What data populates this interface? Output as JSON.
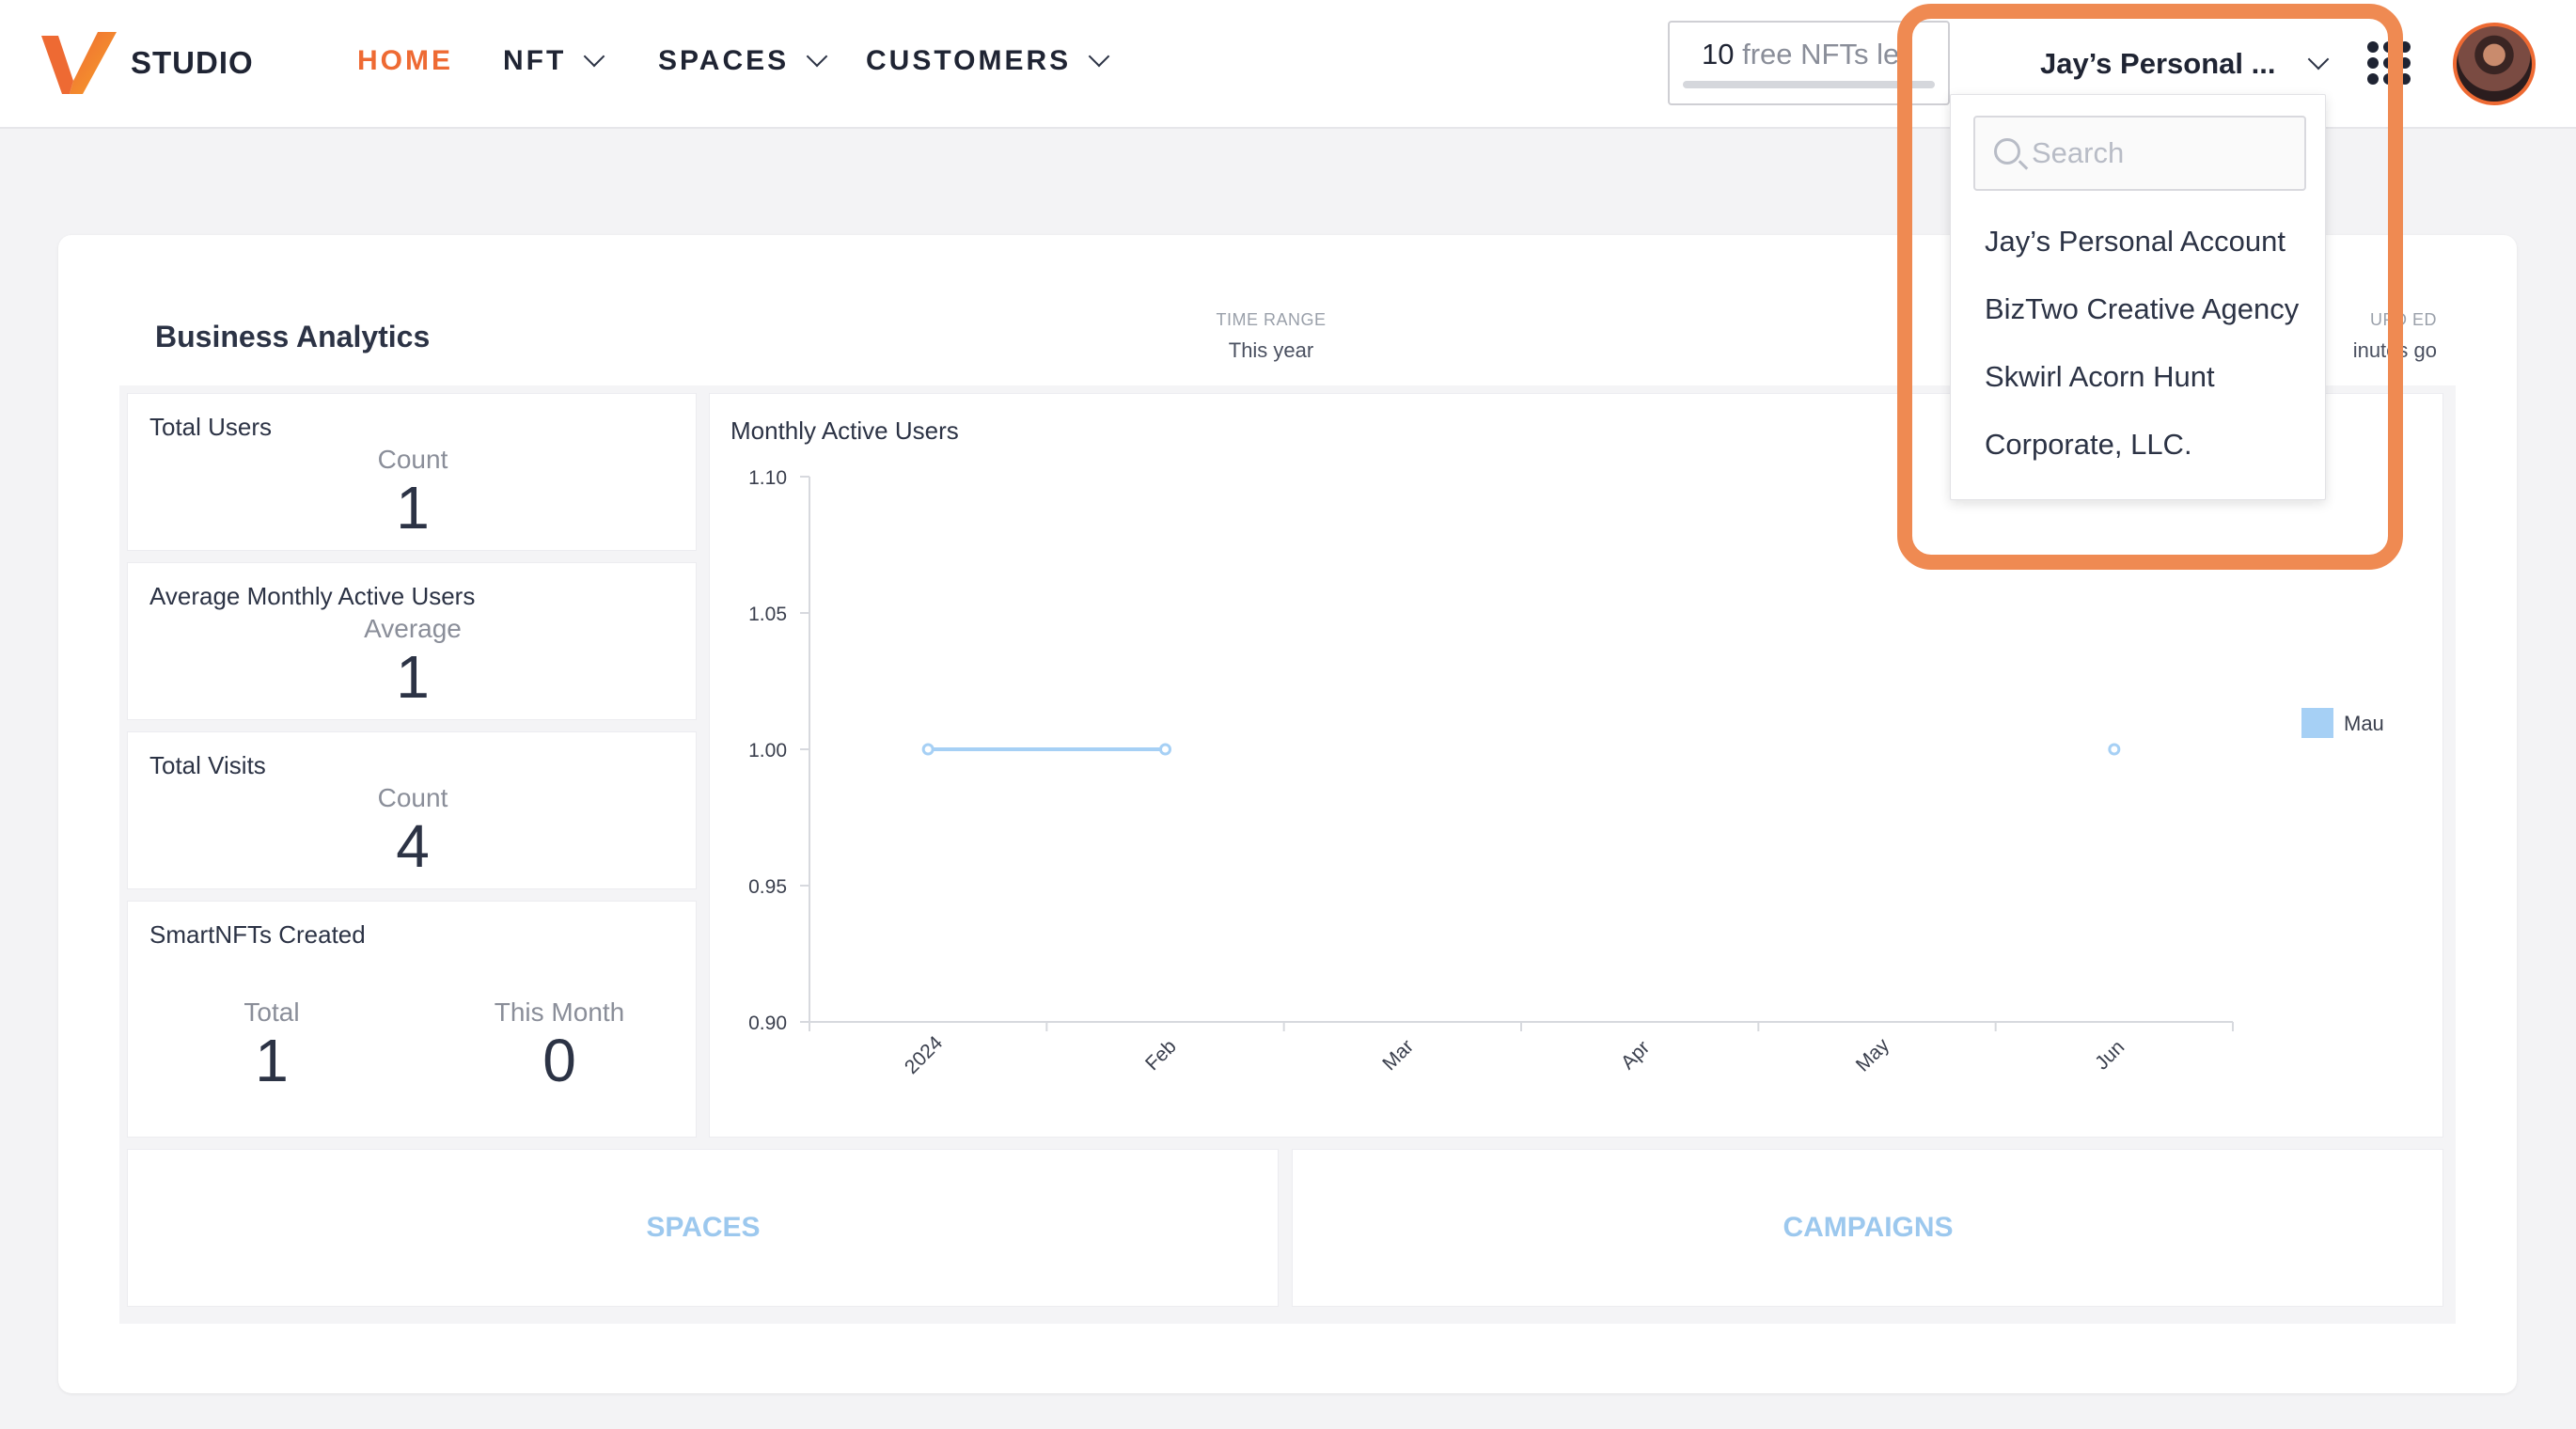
{
  "header": {
    "brand": "STUDIO",
    "nav": [
      {
        "label": "HOME",
        "active": true,
        "has_menu": false
      },
      {
        "label": "NFT",
        "active": false,
        "has_menu": true
      },
      {
        "label": "SPACES",
        "active": false,
        "has_menu": true
      },
      {
        "label": "CUSTOMERS",
        "active": false,
        "has_menu": true
      }
    ],
    "free_nfts": {
      "count": "10",
      "text": "free NFTs le"
    },
    "account_label": "Jay’s Personal ...",
    "accent_color": "#ee6a33"
  },
  "account_dropdown": {
    "search_placeholder": "Search",
    "items": [
      "Jay’s Personal Account",
      "BizTwo Creative Agency",
      "Skwirl Acorn Hunt",
      "Corporate, LLC."
    ]
  },
  "analytics": {
    "title": "Business Analytics",
    "time_range_label": "TIME RANGE",
    "time_range_value": "This year",
    "updated_label": "UPD ED",
    "updated_value": "inutes go"
  },
  "tiles": {
    "total_users": {
      "title": "Total Users",
      "label": "Count",
      "value": "1"
    },
    "avg_mau": {
      "title": "Average Monthly Active Users",
      "label": "Average",
      "value": "1"
    },
    "total_visits": {
      "title": "Total Visits",
      "label": "Count",
      "value": "4"
    },
    "smartnfts": {
      "title": "SmartNFTs Created",
      "total_label": "Total",
      "total_value": "1",
      "month_label": "This Month",
      "month_value": "0"
    }
  },
  "sections": {
    "spaces": "SPACES",
    "campaigns": "CAMPAIGNS"
  },
  "chart_data": {
    "type": "line",
    "title": "Monthly Active Users",
    "categories": [
      "2024",
      "Feb",
      "Mar",
      "Apr",
      "May",
      "Jun"
    ],
    "series": [
      {
        "name": "Mau",
        "color": "#a6d0f5",
        "points": [
          {
            "x": "2024",
            "y": 1.0
          },
          {
            "x": "Feb",
            "y": 1.0
          },
          {
            "x": "Jun",
            "y": 1.0
          }
        ]
      }
    ],
    "y_ticks": [
      "1.10",
      "1.05",
      "1.00",
      "0.95",
      "0.90"
    ],
    "ylim": [
      0.9,
      1.1
    ],
    "legend_position": "right",
    "grid": false
  }
}
